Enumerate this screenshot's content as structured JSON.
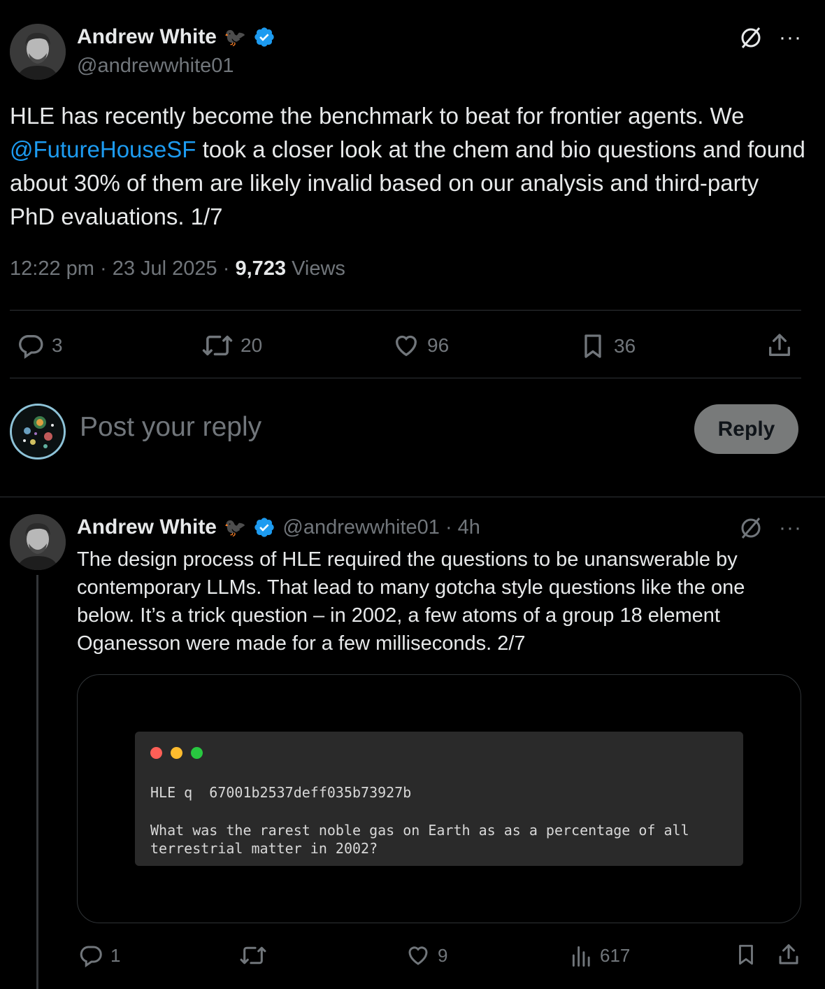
{
  "main_post": {
    "author_name": "Andrew White",
    "author_emoji": "🐦‍⬛",
    "handle": "@andrewwhite01",
    "text_before_mention": "HLE has recently become the benchmark to beat for frontier agents. We ",
    "mention": "@FutureHouseSF",
    "text_after_mention": " took a closer look at the chem and bio questions and found about 30% of them are likely invalid based on our analysis and third-party PhD evaluations. 1/7",
    "time": "12:22 pm",
    "date": "23 Jul 2025",
    "views_count": "9,723",
    "views_label": "Views",
    "stats": {
      "replies": "3",
      "reposts": "20",
      "likes": "96",
      "bookmarks": "36"
    }
  },
  "composer": {
    "placeholder": "Post your reply",
    "button_label": "Reply"
  },
  "reply_post": {
    "author_name": "Andrew White",
    "author_emoji": "🐦‍⬛",
    "handle": "@andrewwhite01",
    "age": "4h",
    "text": "The design process of HLE required the questions to be unanswerable by contemporary LLMs. That lead to many gotcha style questions like the one below. It’s a trick question – in 2002, a few atoms of a group 18 element Oganesson were made for a few milliseconds. 2/7",
    "media": {
      "header_line": "HLE q  67001b2537deff035b73927b",
      "question_line1": "What was the rarest noble gas on Earth as as a percentage of all",
      "question_line2": "terrestrial matter in 2002?"
    },
    "stats": {
      "replies": "1",
      "likes": "9",
      "views": "617"
    }
  },
  "colors": {
    "background": "#000000",
    "text_primary": "#e7e9ea",
    "text_secondary": "#71767b",
    "accent": "#1d9bf0",
    "divider": "#2f3336",
    "traffic_red": "#ff5f57",
    "traffic_yellow": "#febc2e",
    "traffic_green": "#28c840"
  },
  "icons": [
    "verified-badge-icon",
    "grok-icon",
    "more-icon",
    "reply-icon",
    "repost-icon",
    "like-icon",
    "bookmark-icon",
    "share-icon",
    "views-icon"
  ]
}
